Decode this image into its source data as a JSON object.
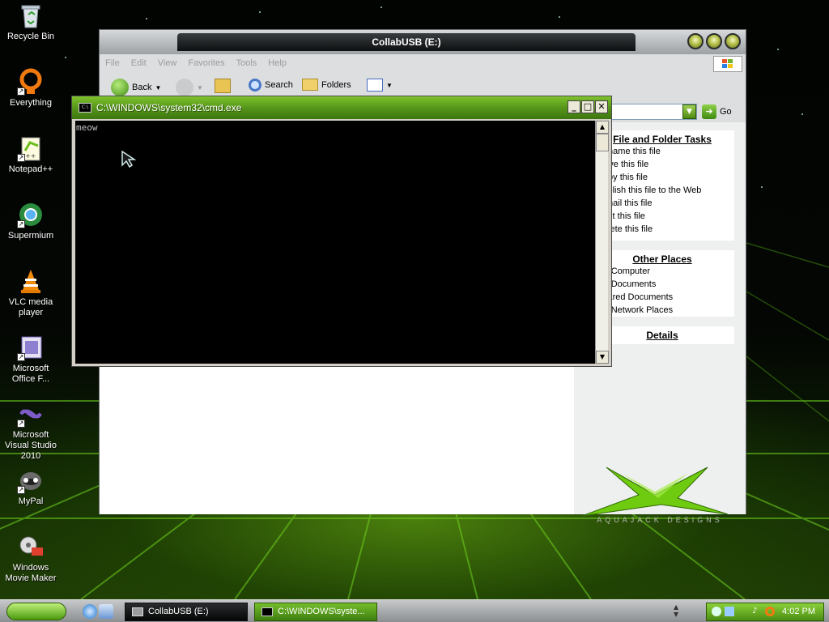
{
  "desktop": {
    "icons": [
      {
        "label": "Recycle Bin",
        "icon": "recycle-bin-icon"
      },
      {
        "label": "Everything",
        "icon": "everything-icon"
      },
      {
        "label": "Notepad++",
        "icon": "notepad-plus-plus-icon"
      },
      {
        "label": "Supermium",
        "icon": "supermium-icon"
      },
      {
        "label": "VLC media player",
        "icon": "vlc-icon"
      },
      {
        "label": "Microsoft Office F...",
        "icon": "office-icon"
      },
      {
        "label": "Microsoft Visual Studio 2010",
        "icon": "visual-studio-icon"
      },
      {
        "label": "MyPal",
        "icon": "mypal-icon"
      },
      {
        "label": "Windows Movie Maker",
        "icon": "movie-maker-icon"
      }
    ]
  },
  "explorer": {
    "title": "CollabUSB (E:)",
    "menu": [
      "File",
      "Edit",
      "View",
      "Favorites",
      "Tools",
      "Help"
    ],
    "toolbar": {
      "back": "Back",
      "search": "Search",
      "folders": "Folders"
    },
    "address": {
      "go": "Go"
    },
    "side": {
      "file_tasks": {
        "title": "File and Folder Tasks",
        "items": [
          "Rename this file",
          "Move this file",
          "Copy this file",
          "Publish this file to the Web",
          "E-mail this file",
          "Print this file",
          "Delete this file"
        ]
      },
      "other_places": {
        "title": "Other Places",
        "items": [
          "My Computer",
          "My Documents",
          "Shared Documents",
          "My Network Places"
        ]
      },
      "details": {
        "title": "Details"
      },
      "logo_text": "AQUAJACK DESIGNS"
    }
  },
  "cmd": {
    "title": "C:\\WINDOWS\\system32\\cmd.exe",
    "output": "meow"
  },
  "taskbar": {
    "tasks": [
      {
        "label": "CollabUSB (E:)",
        "active": false
      },
      {
        "label": "C:\\WINDOWS\\syste...",
        "active": true
      }
    ],
    "clock": "4:02 PM"
  },
  "colors": {
    "accent": "#5a9e1a",
    "cmd_bg": "#000000",
    "cmd_text": "#c0c0c0"
  }
}
